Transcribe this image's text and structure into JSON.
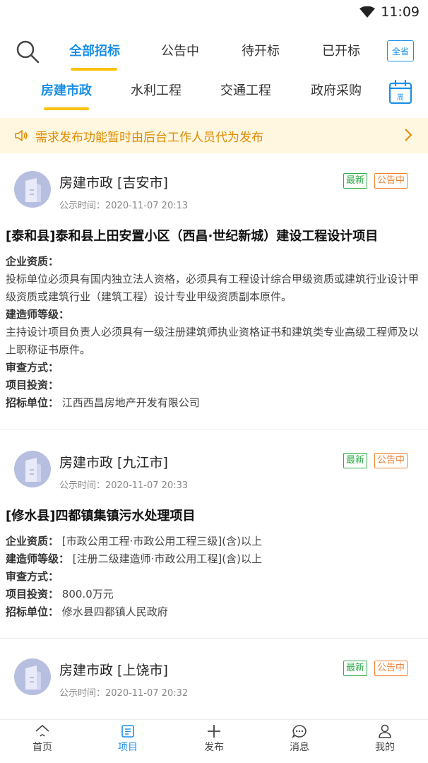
{
  "status_bar": {
    "time": "11:09"
  },
  "tabs": [
    {
      "label": "全部招标",
      "active": true
    },
    {
      "label": "公告中",
      "active": false
    },
    {
      "label": "待开标",
      "active": false
    },
    {
      "label": "已开标",
      "active": false
    }
  ],
  "province_button": "全省",
  "categories": [
    {
      "label": "房建市政",
      "active": true
    },
    {
      "label": "水利工程",
      "active": false
    },
    {
      "label": "交通工程",
      "active": false
    },
    {
      "label": "政府采购",
      "active": false
    }
  ],
  "calendar_label": "周",
  "notice": "需求发布功能暂时由后台工作人员代为发布",
  "labels": {
    "qualification": "企业资质：",
    "builder_level": "建造师等级：",
    "review": "审查方式：",
    "investment": "项目投资：",
    "tenderer": "招标单位："
  },
  "cards": [
    {
      "category": "房建市政 [吉安市]",
      "time": "公示时间：2020-11-07 20:13",
      "badge_new": "最新",
      "badge_status": "公告中",
      "title": "[泰和县]泰和县上田安置小区（西昌·世纪新城）建设工程设计项目",
      "qualification": "投标单位必须具有国内独立法人资格，必须具有工程设计综合甲级资质或建筑行业设计甲级资质或建筑行业（建筑工程）设计专业甲级资质副本原件。",
      "builder_level": "主持设计项目负责人必须具有一级注册建筑师执业资格证书和建筑类专业高级工程师及以上职称证书原件。",
      "review": "",
      "investment": "",
      "tenderer": "江西西昌房地产开发有限公司"
    },
    {
      "category": "房建市政 [九江市]",
      "time": "公示时间：2020-11-07 20:33",
      "badge_new": "最新",
      "badge_status": "公告中",
      "title": "[修水县]四都镇集镇污水处理项目",
      "qualification": "[市政公用工程·市政公用工程三级](含)以上",
      "builder_level": "[注册二级建造师·市政公用工程](含)以上",
      "review": "",
      "investment": "800.0万元",
      "tenderer": "修水县四都镇人民政府"
    },
    {
      "category": "房建市政 [上饶市]",
      "time": "公示时间：2020-11-07 20:32",
      "badge_new": "最新",
      "badge_status": "公告中"
    }
  ],
  "bottom_nav": [
    {
      "label": "首页",
      "icon": "home-icon"
    },
    {
      "label": "项目",
      "icon": "project-icon",
      "active": true
    },
    {
      "label": "发布",
      "icon": "plus-icon"
    },
    {
      "label": "消息",
      "icon": "message-icon"
    },
    {
      "label": "我的",
      "icon": "user-icon"
    }
  ],
  "colors": {
    "accent": "#1a8fe8",
    "underline": "#ffc107",
    "notice_bg": "#fff7e0",
    "notice_text": "#e08a00",
    "badge_new": "#2eaa4a",
    "badge_status": "#f08030"
  }
}
